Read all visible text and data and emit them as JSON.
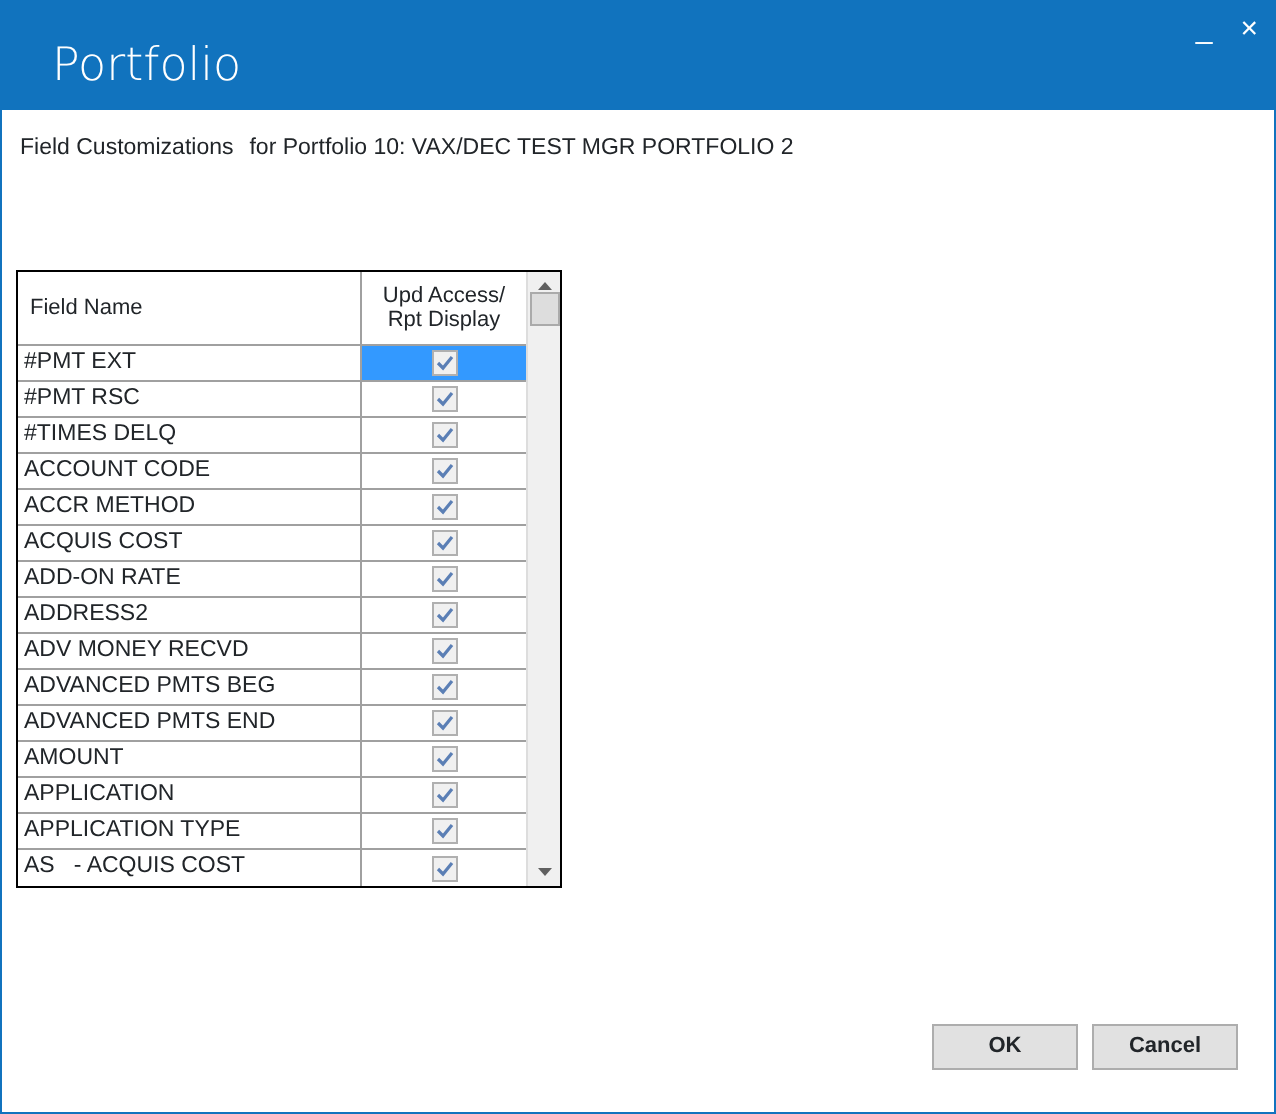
{
  "window": {
    "title": "Portfolio",
    "controls": [
      "_",
      "×"
    ]
  },
  "heading": {
    "label": "Field Customizations",
    "context": "for Portfolio 10: VAX/DEC TEST MGR PORTFOLIO 2"
  },
  "grid": {
    "columns": [
      "Field Name",
      "Upd Access/\nRpt Display"
    ],
    "rows": [
      {
        "field": "#PMT EXT",
        "checked": true,
        "disabled": true,
        "selected": true
      },
      {
        "field": "#PMT RSC",
        "checked": true,
        "disabled": true,
        "selected": false
      },
      {
        "field": "#TIMES DELQ",
        "checked": true,
        "disabled": true,
        "selected": false
      },
      {
        "field": "ACCOUNT CODE",
        "checked": true,
        "disabled": true,
        "selected": false
      },
      {
        "field": "ACCR METHOD",
        "checked": true,
        "disabled": true,
        "selected": false
      },
      {
        "field": "ACQUIS COST",
        "checked": true,
        "disabled": true,
        "selected": false
      },
      {
        "field": "ADD-ON RATE",
        "checked": true,
        "disabled": true,
        "selected": false
      },
      {
        "field": "ADDRESS2",
        "checked": true,
        "disabled": true,
        "selected": false
      },
      {
        "field": "ADV MONEY RECVD",
        "checked": true,
        "disabled": true,
        "selected": false
      },
      {
        "field": "ADVANCED PMTS BEG",
        "checked": true,
        "disabled": true,
        "selected": false
      },
      {
        "field": "ADVANCED PMTS END",
        "checked": true,
        "disabled": true,
        "selected": false
      },
      {
        "field": "AMOUNT",
        "checked": true,
        "disabled": true,
        "selected": false
      },
      {
        "field": "APPLICATION",
        "checked": true,
        "disabled": true,
        "selected": false
      },
      {
        "field": "APPLICATION TYPE",
        "checked": true,
        "disabled": true,
        "selected": false
      },
      {
        "field": "AS   - ACQUIS COST",
        "checked": true,
        "disabled": true,
        "selected": false
      }
    ]
  },
  "buttons": [
    "OK",
    "Cancel"
  ]
}
